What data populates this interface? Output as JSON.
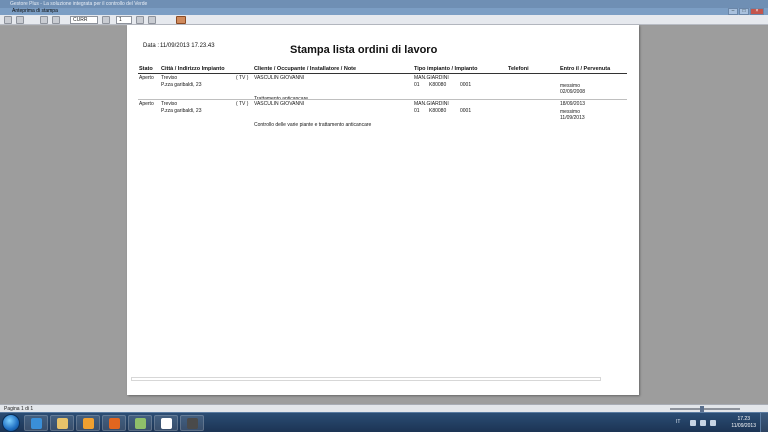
{
  "app": {
    "title": "Gestore Plus - La soluzione integrata per il controllo del Verde"
  },
  "preview": {
    "window_title": "Anteprima di stampa",
    "zoom_value": "CURR",
    "page_input_value": "1"
  },
  "report": {
    "date_label": "Data :",
    "date_value": "11/09/2013 17.23.43",
    "title": "Stampa lista ordini di lavoro",
    "columns": {
      "stato": "Stato",
      "citta": "Città / Indirizzo Impianto",
      "cliente": "Cliente / Occupante / Installatore / Note",
      "tipo": "Tipo impianto / Impianto",
      "telefoni": "Telefoni",
      "entro": "Entro il / Pervenuta"
    },
    "rows": [
      {
        "stato": "Aperto",
        "citta": "Treviso",
        "indirizzo": "P.zza garibaldi, 23",
        "provincia": "( TV )",
        "cliente": "VASCULIN GIOVANNI",
        "note": "Trattamento anticancare",
        "tipo_impianto": "MAN.GIARDINI",
        "imp_a": "01",
        "imp_b": "K80080",
        "imp_c": "0001",
        "entro": "",
        "ricevuto": "messimo",
        "pervenuta": "02/09/2008",
        "descrizione": ""
      },
      {
        "stato": "Aperto",
        "citta": "Treviso",
        "indirizzo": "P.zza garibaldi, 23",
        "provincia": "( TV )",
        "cliente": "VASCULIN GIOVANNI",
        "note": "",
        "tipo_impianto": "MAN.GIARDINI",
        "imp_a": "01",
        "imp_b": "K80080",
        "imp_c": "0001",
        "entro": "18/09/2013",
        "ricevuto": "messimo",
        "pervenuta": "11/09/2013",
        "descrizione": "Controllo delle varie piante e trattamento anticancare"
      }
    ]
  },
  "status_bar": {
    "page_text": "Pagina 1 di 1"
  },
  "taskbar": {
    "language": "IT",
    "time": "17.23",
    "date": "11/09/2013",
    "items": [
      {
        "name": "internet-explorer-icon",
        "color": "#3a8fd8"
      },
      {
        "name": "file-explorer-icon",
        "color": "#e7c26a"
      },
      {
        "name": "media-player-icon",
        "color": "#f0a030"
      },
      {
        "name": "firefox-icon",
        "color": "#e2661f"
      },
      {
        "name": "app-window-icon",
        "color": "#8fbf6a"
      },
      {
        "name": "gestore-plus-icon",
        "color": "#ffffff"
      },
      {
        "name": "unknown-app-icon",
        "color": "#4a4a4a"
      }
    ]
  }
}
